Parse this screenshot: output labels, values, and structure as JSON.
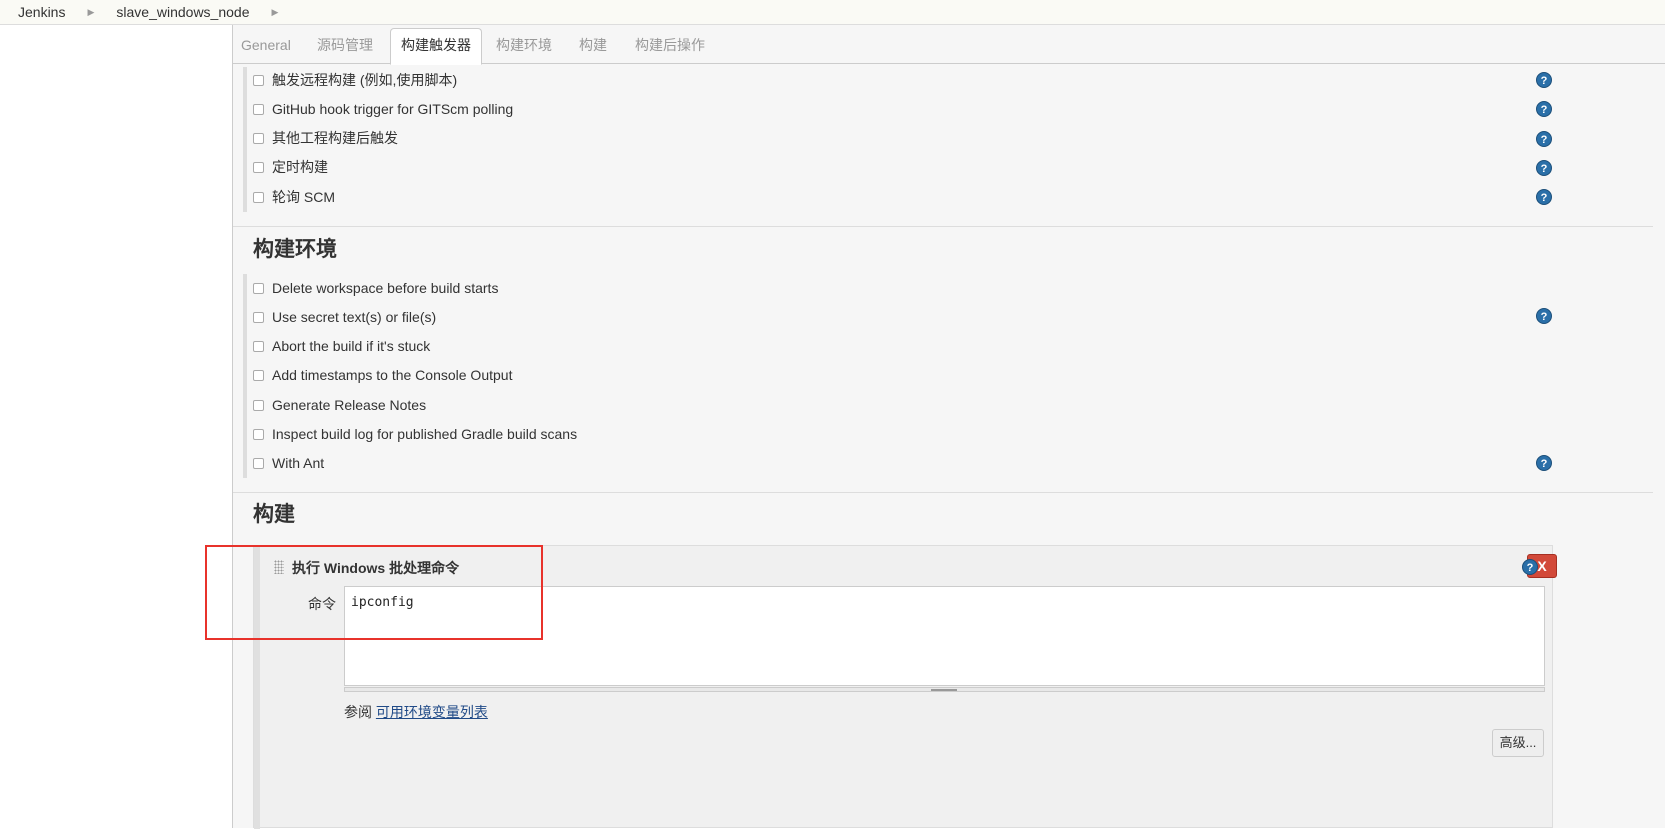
{
  "breadcrumb": {
    "items": [
      "Jenkins",
      "slave_windows_node"
    ]
  },
  "tabs": [
    "General",
    "源码管理",
    "构建触发器",
    "构建环境",
    "构建",
    "构建后操作"
  ],
  "active_tab": "构建触发器",
  "triggers": {
    "options": [
      {
        "label": "触发远程构建 (例如,使用脚本)",
        "checked": false,
        "help": true
      },
      {
        "label": "GitHub hook trigger for GITScm polling",
        "checked": false,
        "help": true
      },
      {
        "label": "其他工程构建后触发",
        "checked": false,
        "help": true
      },
      {
        "label": "定时构建",
        "checked": false,
        "help": true
      },
      {
        "label": "轮询 SCM",
        "checked": false,
        "help": true
      }
    ]
  },
  "build_env": {
    "title": "构建环境",
    "options": [
      {
        "label": "Delete workspace before build starts",
        "checked": false,
        "help": false
      },
      {
        "label": "Use secret text(s) or file(s)",
        "checked": false,
        "help": true
      },
      {
        "label": "Abort the build if it's stuck",
        "checked": false,
        "help": false
      },
      {
        "label": "Add timestamps to the Console Output",
        "checked": false,
        "help": false
      },
      {
        "label": "Generate Release Notes",
        "checked": false,
        "help": false
      },
      {
        "label": "Inspect build log for published Gradle build scans",
        "checked": false,
        "help": false
      },
      {
        "label": "With Ant",
        "checked": false,
        "help": true
      }
    ]
  },
  "build": {
    "title": "构建",
    "step_title": "执行 Windows 批处理命令",
    "delete_label": "X",
    "command_label": "命令",
    "command_value": "ipconfig",
    "env_prefix": "参阅",
    "env_link": "可用环境变量列表",
    "advanced_label": "高级..."
  },
  "help_glyph": "?",
  "colors": {
    "delete_button": "#d24939",
    "help_icon": "#2a6fa8",
    "highlight": "#e8322b",
    "link": "#204a87"
  }
}
